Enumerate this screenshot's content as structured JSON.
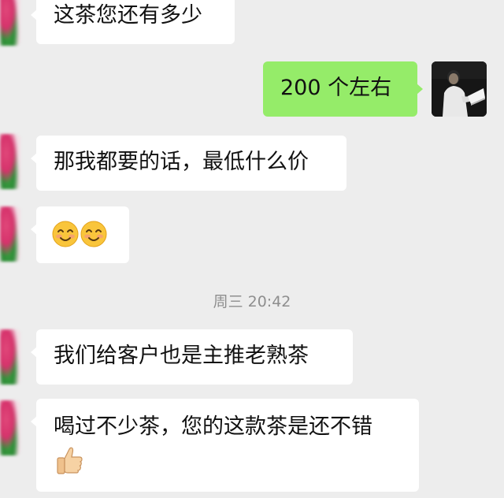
{
  "messages": [
    {
      "side": "left",
      "text": "这茶您还有多少"
    },
    {
      "side": "right",
      "text": "200 个左右"
    },
    {
      "side": "left",
      "text": "那我都要的话，最低什么价"
    },
    {
      "side": "left",
      "emoji": [
        "smiling-face-icon",
        "smiling-face-icon"
      ]
    },
    {
      "side": "left",
      "text": "我们给客户也是主推老熟茶"
    },
    {
      "side": "left",
      "text": "喝过不少茶，您的这款茶是还不错",
      "emoji": [
        "thumbs-up-icon"
      ]
    }
  ],
  "timestamp": "周三 20:42",
  "colors": {
    "background": "#ededed",
    "left_bubble": "#ffffff",
    "right_bubble": "#95ec69",
    "timestamp_text": "#8e8e8e"
  }
}
